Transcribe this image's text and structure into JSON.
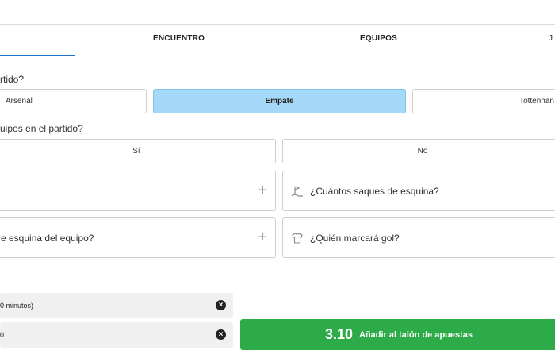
{
  "tabs": [
    {
      "label": "ENCUENTRO"
    },
    {
      "label": "EQUIPOS"
    },
    {
      "label": "J"
    }
  ],
  "question1": {
    "text": "rtido?",
    "options": [
      "Arsenal",
      "Empate",
      "Tottenhan"
    ],
    "selected": "Empate"
  },
  "question2": {
    "text": "uipos en el partido?",
    "options": [
      "Sí",
      "No"
    ]
  },
  "cards": [
    {
      "label": "",
      "icon": "plus-icon"
    },
    {
      "label": "¿Cuántos saques de esquina?",
      "icon": "corner-flag-icon"
    },
    {
      "label": "e esquina del equipo?",
      "icon": "plus-icon"
    },
    {
      "label": "¿Quién marcará gol?",
      "icon": "shirt-icon"
    }
  ],
  "selections": [
    {
      "text": "0 minutos)"
    },
    {
      "text": "0"
    }
  ],
  "bet_button": {
    "odds": "3.10",
    "label": "Añadir al talón de apuestas"
  },
  "colors": {
    "accent": "#1a73c7",
    "selected_option": "#a6d9f7",
    "bet_button": "#2eab49"
  }
}
